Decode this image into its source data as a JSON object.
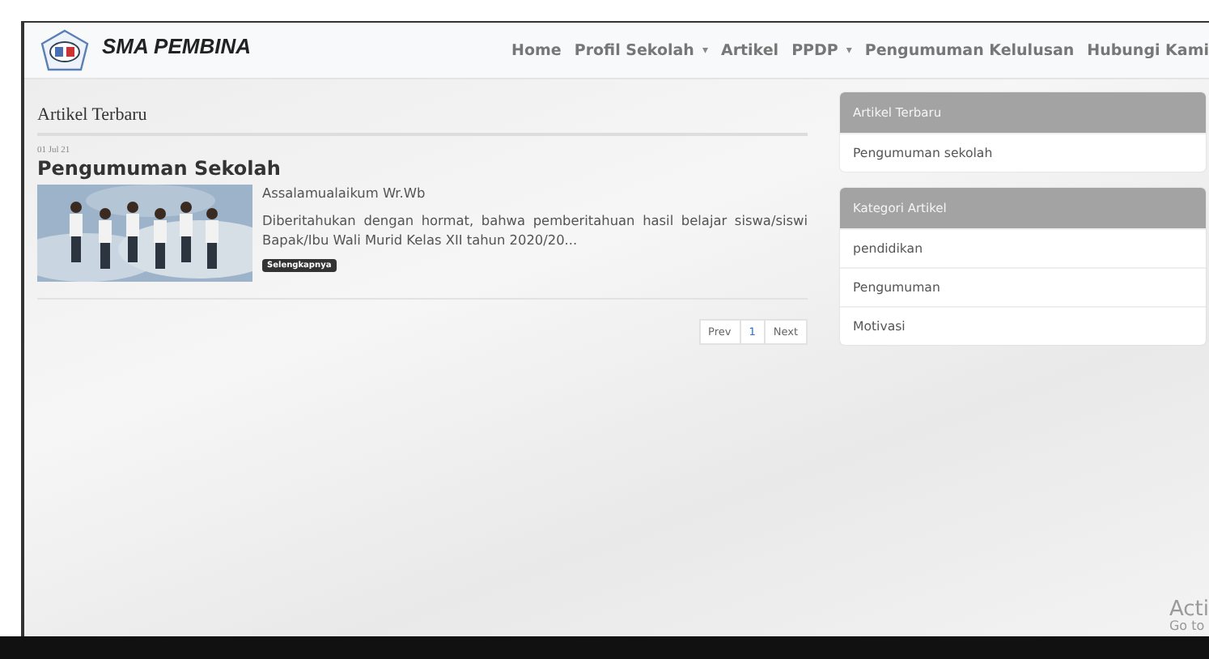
{
  "navbar": {
    "brand": "SMA PEMBINA",
    "links": [
      {
        "label": "Home",
        "dropdown": false
      },
      {
        "label": "Profil Sekolah",
        "dropdown": true
      },
      {
        "label": "Artikel",
        "dropdown": false
      },
      {
        "label": "PPDP",
        "dropdown": true
      },
      {
        "label": "Pengumuman Kelulusan",
        "dropdown": false
      },
      {
        "label": "Hubungi Kami",
        "dropdown": false
      }
    ],
    "caret": "▾"
  },
  "main": {
    "heading": "Artikel Terbaru",
    "articles": [
      {
        "date": "01 Jul 21",
        "title": "Pengumuman Sekolah",
        "greeting": "Assalamualaikum Wr.Wb",
        "excerpt": "Diberitahukan dengan hormat, bahwa pemberitahuan hasil belajar siswa/siswi Bapak/Ibu Wali Murid Kelas XII tahun 2020/20...",
        "more": "Selengkapnya"
      }
    ],
    "pagination": [
      {
        "label": "Prev",
        "selected": false
      },
      {
        "label": "1",
        "selected": true
      },
      {
        "label": "Next",
        "selected": false
      }
    ]
  },
  "sidebar": [
    {
      "title": "Artikel Terbaru",
      "items": [
        "Pengumuman sekolah"
      ]
    },
    {
      "title": "Kategori Artikel",
      "items": [
        "pendidikan",
        "Pengumuman",
        "Motivasi"
      ]
    }
  ],
  "overlay": {
    "line_1": "Acti",
    "line_2": "Go to"
  }
}
